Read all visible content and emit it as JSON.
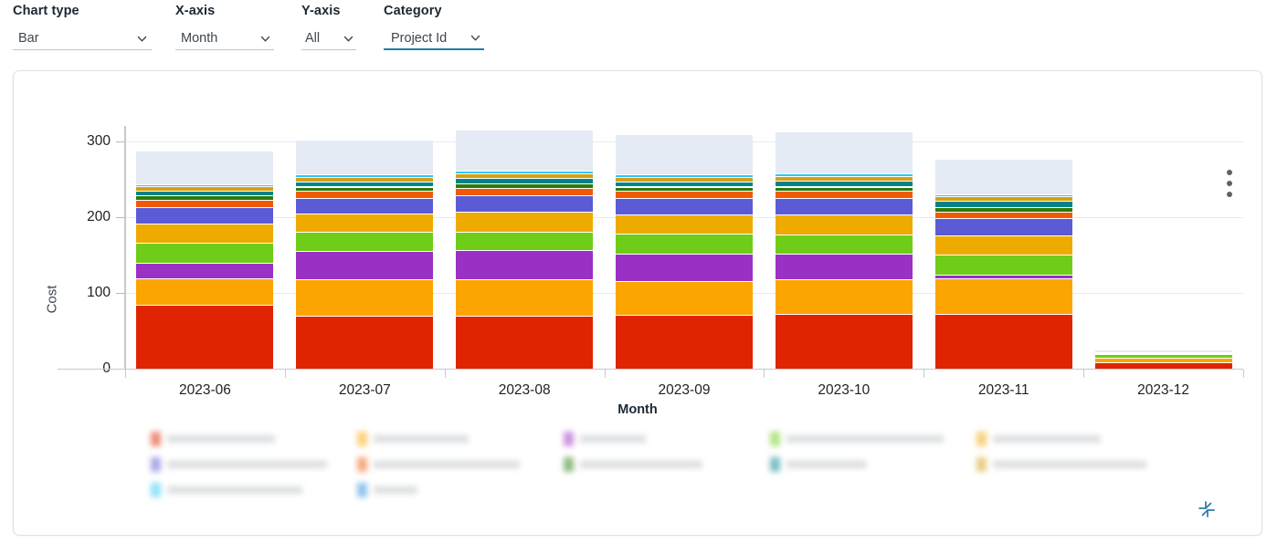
{
  "controls": [
    {
      "label": "Chart type",
      "value": "Bar",
      "name": "chart-type",
      "active": false
    },
    {
      "label": "X-axis",
      "value": "Month",
      "name": "x-axis",
      "active": false
    },
    {
      "label": "Y-axis",
      "value": "All",
      "name": "y-axis",
      "active": false
    },
    {
      "label": "Category",
      "value": "Project Id",
      "name": "category",
      "active": true
    }
  ],
  "card": {
    "menu_icon": "kebab-menu-icon",
    "collapse_icon": "collapse-arrows-icon",
    "accent_color": "#1a7fa8"
  },
  "chart_data": {
    "type": "bar",
    "stacked": true,
    "title": "",
    "xlabel": "Month",
    "ylabel": "Cost",
    "categories": [
      "2023-06",
      "2023-07",
      "2023-08",
      "2023-09",
      "2023-10",
      "2023-11",
      "2023-12"
    ],
    "ylim": [
      0,
      320
    ],
    "yticks": [
      0,
      100,
      200,
      300
    ],
    "grid": true,
    "legend_position": "bottom",
    "legend_redacted": true,
    "totals": [
      288,
      302,
      315,
      309,
      313,
      277,
      25
    ],
    "series": [
      {
        "name": "series-1",
        "color": "#e02401",
        "values": [
          84,
          70,
          70,
          71,
          72,
          72,
          8
        ]
      },
      {
        "name": "series-2",
        "color": "#fca400",
        "values": [
          35,
          48,
          48,
          44,
          46,
          47,
          7
        ]
      },
      {
        "name": "series-3",
        "color": "#9b30c4",
        "values": [
          21,
          37,
          38,
          37,
          34,
          5,
          0
        ]
      },
      {
        "name": "series-4",
        "color": "#6fcc19",
        "values": [
          26,
          25,
          25,
          26,
          25,
          26,
          4
        ]
      },
      {
        "name": "series-5",
        "color": "#efaa00",
        "values": [
          25,
          24,
          26,
          25,
          26,
          26,
          0
        ]
      },
      {
        "name": "series-6",
        "color": "#5b5bd6",
        "values": [
          22,
          21,
          22,
          22,
          22,
          22,
          2
        ]
      },
      {
        "name": "series-7",
        "color": "#f05a05",
        "values": [
          9,
          9,
          9,
          9,
          9,
          9,
          1
        ]
      },
      {
        "name": "series-8",
        "color": "#2b7a0b",
        "values": [
          6,
          6,
          6,
          6,
          6,
          6,
          0
        ]
      },
      {
        "name": "series-9",
        "color": "#00838a",
        "values": [
          7,
          7,
          8,
          7,
          8,
          8,
          0
        ]
      },
      {
        "name": "series-10",
        "color": "#d4a017",
        "values": [
          5,
          6,
          6,
          6,
          6,
          6,
          0
        ]
      },
      {
        "name": "series-11",
        "color": "#2ec8f5",
        "values": [
          3,
          3,
          3,
          3,
          3,
          3,
          0
        ]
      },
      {
        "name": "series-12",
        "color": "#e4ebf5",
        "values": [
          45,
          46,
          54,
          53,
          56,
          47,
          3
        ]
      }
    ],
    "legend_columns": [
      {
        "items": [
          {
            "color": "#e02401",
            "text_width": 118
          },
          {
            "color": "#5b5bd6",
            "text_width": 175
          },
          {
            "color": "#2ec8f5",
            "text_width": 148
          }
        ]
      },
      {
        "items": [
          {
            "color": "#fca400",
            "text_width": 104
          },
          {
            "color": "#f05a05",
            "text_width": 160
          },
          {
            "color": "#2b8ee0",
            "text_width": 48
          }
        ]
      },
      {
        "items": [
          {
            "color": "#9b30c4",
            "text_width": 72
          },
          {
            "color": "#2b7a0b",
            "text_width": 134
          }
        ]
      },
      {
        "items": [
          {
            "color": "#6fcc19",
            "text_width": 172
          },
          {
            "color": "#00838a",
            "text_width": 88
          }
        ]
      },
      {
        "items": [
          {
            "color": "#efaa00",
            "text_width": 118
          },
          {
            "color": "#d4a017",
            "text_width": 168
          }
        ]
      }
    ]
  }
}
